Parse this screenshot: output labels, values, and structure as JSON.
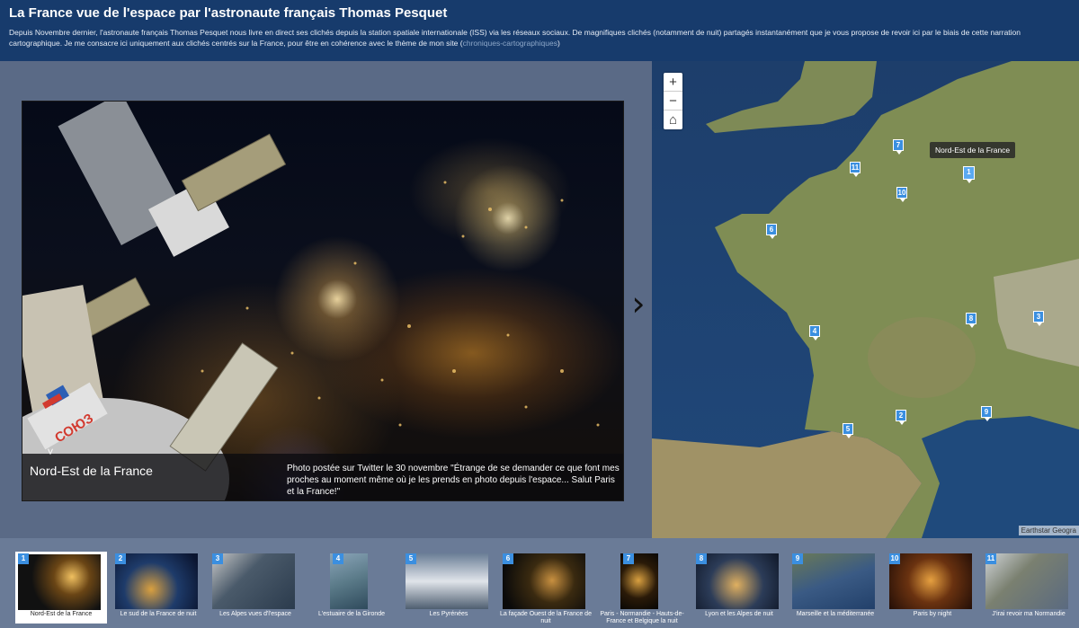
{
  "header": {
    "title": "La France vue de l'espace par l'astronaute français Thomas Pesquet",
    "description": "Depuis Novembre dernier, l'astronaute français Thomas Pesquet nous livre en direct ses clichés depuis la station spatiale internationale (ISS) via les réseaux sociaux. De magnifiques clichés (notamment de nuit) partagés instantanément que je vous propose de revoir ici par le biais de cette narration cartographique. Je me consacre ici uniquement aux clichés centrés sur la France, pour être en cohérence avec le thème de mon site (",
    "link_text": "chroniques-cartographiques",
    "description_end": ")"
  },
  "media": {
    "title": "Nord-Est de la France",
    "caption": "Photo postée sur Twitter le 30 novembre \"Étrange de se demander ce que font mes proches au moment même où je les prends en photo depuis l'espace... Salut Paris et la France!\"",
    "toggle_icon": "˅",
    "next_icon": "›",
    "module_text": "СОЮЗ"
  },
  "map": {
    "zoom_in": "+",
    "zoom_out": "−",
    "home_icon": "⌂",
    "tooltip": "Nord-Est de la France",
    "attribution": "Earthstar Geogra",
    "markers": [
      "1",
      "2",
      "3",
      "4",
      "5",
      "6",
      "7",
      "8",
      "9",
      "10",
      "11"
    ]
  },
  "carousel": [
    {
      "num": "1",
      "label": "Nord-Est de la France",
      "active": true
    },
    {
      "num": "2",
      "label": "Le sud de la France de nuit"
    },
    {
      "num": "3",
      "label": "Les Alpes vues d'l'espace"
    },
    {
      "num": "4",
      "label": "L'estuaire de la Gironde"
    },
    {
      "num": "5",
      "label": "Les Pyrénées"
    },
    {
      "num": "6",
      "label": "La façade Ouest de la France de nuit"
    },
    {
      "num": "7",
      "label": "Paris - Normandie - Hauts-de-France et Belgique la nuit"
    },
    {
      "num": "8",
      "label": "Lyon et les Alpes de nuit"
    },
    {
      "num": "9",
      "label": "Marseille et la méditerranée"
    },
    {
      "num": "10",
      "label": "Paris by night"
    },
    {
      "num": "11",
      "label": "J'irai revoir ma Normandie"
    }
  ]
}
